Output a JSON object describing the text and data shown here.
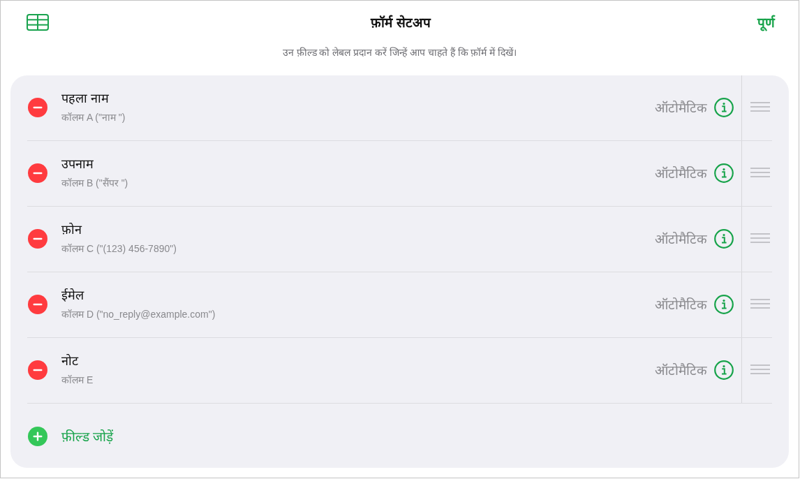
{
  "header": {
    "title": "फ़ॉर्म सेटअप",
    "done_button": "पूर्ण",
    "subtitle": "उन फ़ील्ड को लेबल प्रदान करें जिन्हें आप चाहते हैं कि फ़ॉर्म में दिखें।"
  },
  "fields": [
    {
      "name": "पहला नाम",
      "column": "कॉलम A (\"नाम \")",
      "type_label": "ऑटोमैटिक"
    },
    {
      "name": "उपनाम",
      "column": "कॉलम B (\"सैंपर \")",
      "type_label": "ऑटोमैटिक"
    },
    {
      "name": "फ़ोन",
      "column": "कॉलम C (\"(123) 456-7890\")",
      "type_label": "ऑटोमैटिक"
    },
    {
      "name": "ईमेल",
      "column": "कॉलम D (\"no_reply@example.com\")",
      "type_label": "ऑटोमैटिक"
    },
    {
      "name": "नोट",
      "column": "कॉलम E",
      "type_label": "ऑटोमैटिक"
    }
  ],
  "add_field": {
    "label": "फ़ील्ड जोड़ें"
  }
}
